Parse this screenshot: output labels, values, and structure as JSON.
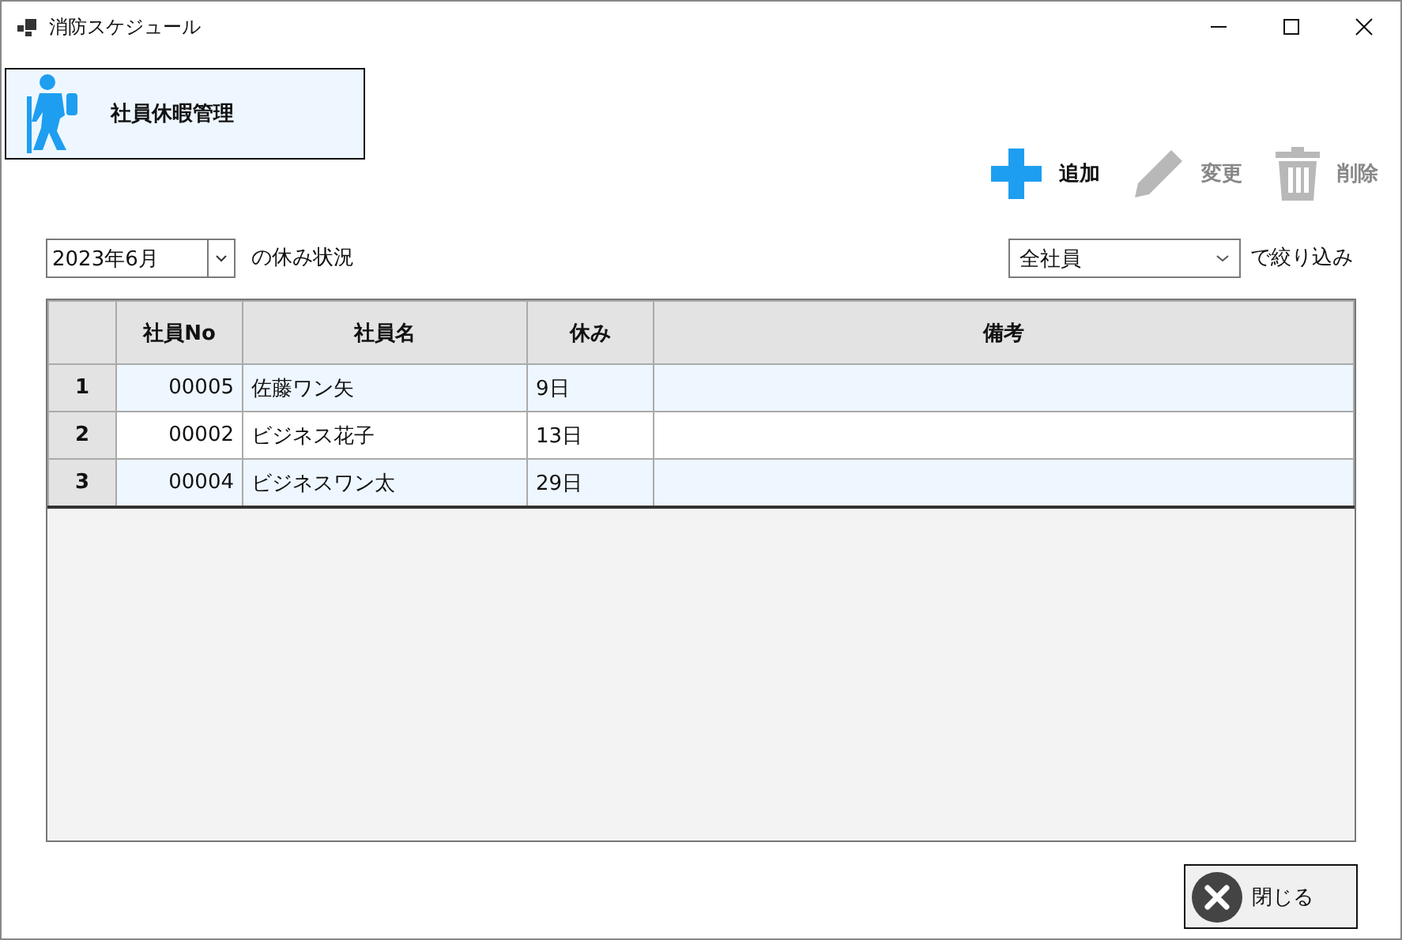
{
  "window": {
    "title": "消防スケジュール"
  },
  "header": {
    "title": "社員休暇管理"
  },
  "toolbar": [
    {
      "kind": "add",
      "label": "追加",
      "disabled": false
    },
    {
      "kind": "edit",
      "label": "変更",
      "disabled": true
    },
    {
      "kind": "delete",
      "label": "削除",
      "disabled": true
    }
  ],
  "month_select": {
    "value": "2023年6月"
  },
  "month_label": "の休み状況",
  "filter_select": {
    "value": "全社員"
  },
  "filter_label": "で絞り込み",
  "table": {
    "columns": [
      "社員No",
      "社員名",
      "休み",
      "備考"
    ],
    "rows": [
      {
        "row_header": "1",
        "cells": [
          "00005",
          "佐藤ワン矢",
          "9日",
          ""
        ]
      },
      {
        "row_header": "2",
        "cells": [
          "00002",
          "ビジネス花子",
          "13日",
          ""
        ]
      },
      {
        "row_header": "3",
        "cells": [
          "00004",
          "ビジネスワン太",
          "29日",
          ""
        ]
      }
    ]
  },
  "close_button": {
    "label": "閉じる"
  }
}
